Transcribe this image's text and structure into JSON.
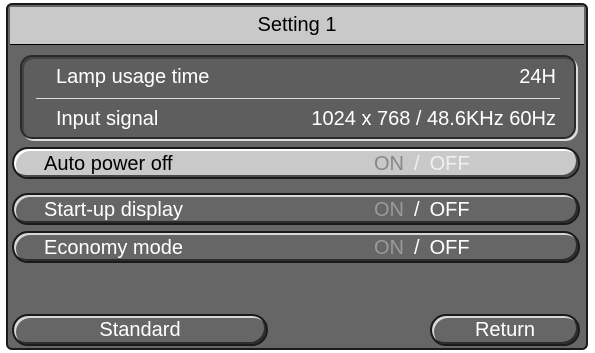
{
  "title": "Setting 1",
  "info": {
    "lamp_label": "Lamp usage time",
    "lamp_value": "24H",
    "input_label": "Input signal",
    "input_value": "1024 x 768 / 48.6KHz  60Hz"
  },
  "options": [
    {
      "label": "Auto power off",
      "on": "ON",
      "sep": "/",
      "off": "OFF",
      "selected": true
    },
    {
      "label": "Start-up display",
      "on": "ON",
      "sep": "/",
      "off": "OFF",
      "selected": false
    },
    {
      "label": "Economy mode",
      "on": "ON",
      "sep": "/",
      "off": "OFF",
      "selected": false
    }
  ],
  "buttons": {
    "standard": "Standard",
    "return": "Return"
  },
  "colors": {
    "panel_bg": "#666666",
    "title_bg": "#c9c9c9",
    "selected_bg": "#c9c9c9",
    "inactive_text": "#9a9a9a"
  }
}
